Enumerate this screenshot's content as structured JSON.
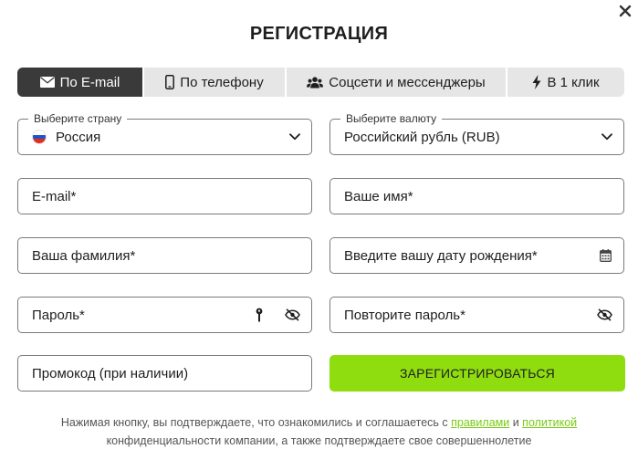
{
  "title": "РЕГИСТРАЦИЯ",
  "tabs": [
    {
      "label": "По E-mail",
      "icon": "envelope-icon",
      "active": true
    },
    {
      "label": "По телефону",
      "icon": "phone-icon",
      "active": false
    },
    {
      "label": "Соцсети и мессенджеры",
      "icon": "users-icon",
      "active": false
    },
    {
      "label": "В 1 клик",
      "icon": "lightning-icon",
      "active": false
    }
  ],
  "country": {
    "label": "Выберите страну",
    "value": "Россия",
    "flag_colors": [
      "#ffffff",
      "#1c57c9",
      "#e52a1f"
    ]
  },
  "currency": {
    "label": "Выберите валюту",
    "value": "Российский рубль (RUB)"
  },
  "fields": {
    "email": "E-mail*",
    "name": "Ваше имя*",
    "surname": "Ваша фамилия*",
    "birthdate": "Введите вашу дату рождения*",
    "password": "Пароль*",
    "password_repeat": "Повторите пароль*",
    "promo": "Промокод (при наличии)"
  },
  "submit_label": "ЗАРЕГИСТРИРОВАТЬСЯ",
  "notice": {
    "before": "Нажимая кнопку, вы подтверждаете, что ознакомились и соглашаетесь с ",
    "rules_link": "правилами",
    "and": " и ",
    "policy_link": "политикой",
    "after": " конфиденциальности компании, а также подтверждаете свое совершеннолетие"
  },
  "colors": {
    "accent": "#8fdd0e",
    "link": "#7acb13",
    "tab_active": "#3a3a3a",
    "tab_bg": "#e6e6e6"
  }
}
